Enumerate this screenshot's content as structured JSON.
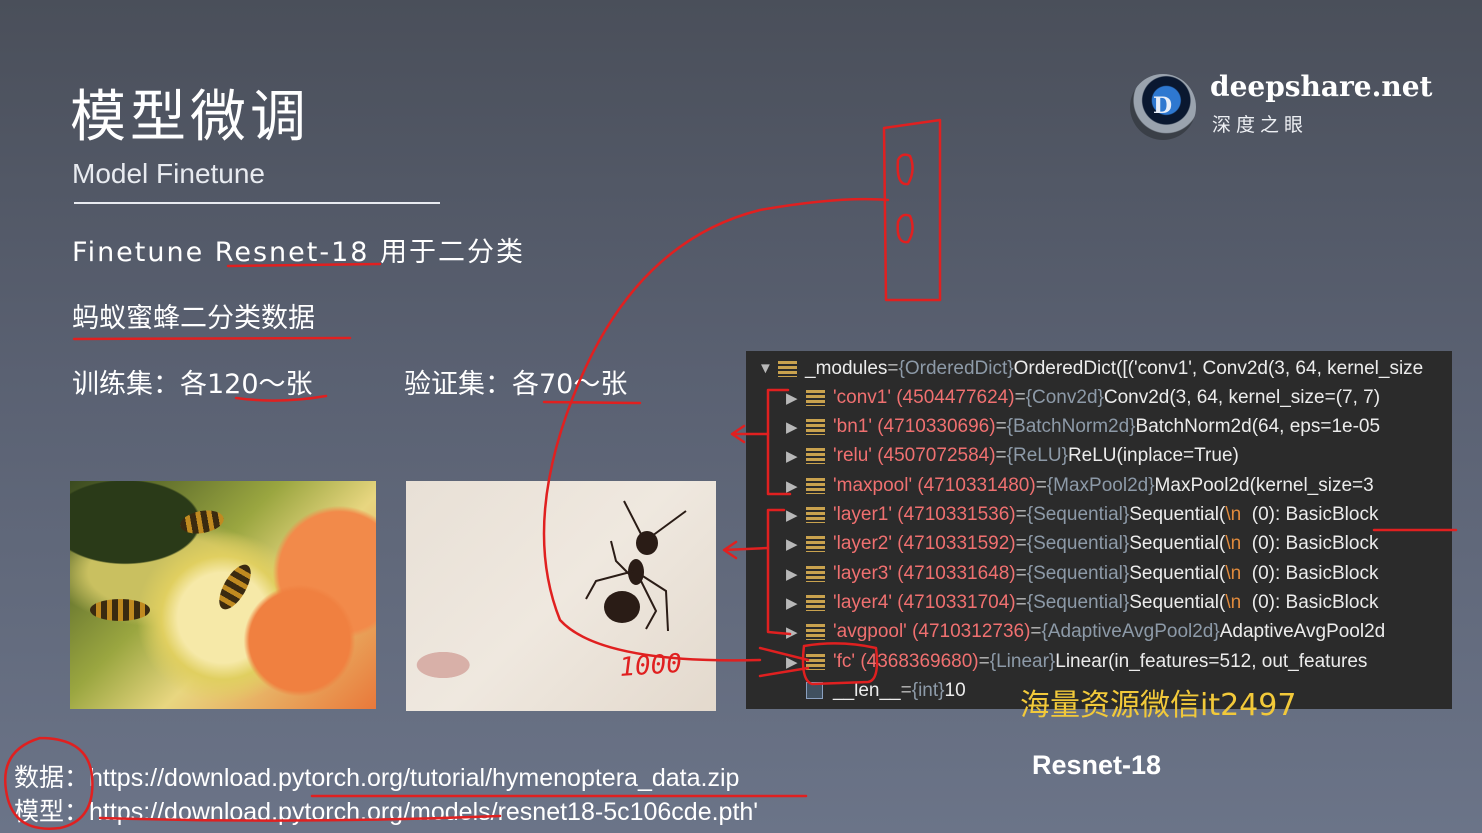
{
  "slide": {
    "title": "模型微调",
    "subtitle": "Model Finetune",
    "line1": "Finetune Resnet-18 用于二分类",
    "line2": "蚂蚁蜜蜂二分类数据",
    "train": "训练集：各120～张",
    "val": "验证集：各70～张"
  },
  "logo": {
    "letter": "D",
    "brand": "deepshare.net",
    "brand_cn": "深度之眼"
  },
  "panel": {
    "rows": [
      {
        "arrow": "▼",
        "key": "_modules",
        "key_plain": true,
        "type": "{OrderedDict}",
        "value": "OrderedDict([('conv1', Conv2d(3, 64, kernel_size"
      },
      {
        "arrow": "▶",
        "key": "'conv1' (4504477624)",
        "type": "{Conv2d}",
        "value": "Conv2d(3, 64, kernel_size=(7, 7)"
      },
      {
        "arrow": "▶",
        "key": "'bn1' (4710330696)",
        "type": "{BatchNorm2d}",
        "value": "BatchNorm2d(64, eps=1e-05"
      },
      {
        "arrow": "▶",
        "key": "'relu' (4507072584)",
        "type": "{ReLU}",
        "value": "ReLU(inplace=True)"
      },
      {
        "arrow": "▶",
        "key": "'maxpool' (4710331480)",
        "type": "{MaxPool2d}",
        "value": "MaxPool2d(kernel_size=3"
      },
      {
        "arrow": "▶",
        "key": "'layer1' (4710331536)",
        "type": "{Sequential}",
        "value": "Sequential(",
        "nl": "\\n",
        "tail": "  (0): BasicBlock"
      },
      {
        "arrow": "▶",
        "key": "'layer2' (4710331592)",
        "type": "{Sequential}",
        "value": "Sequential(",
        "nl": "\\n",
        "tail": "  (0): BasicBlock"
      },
      {
        "arrow": "▶",
        "key": "'layer3' (4710331648)",
        "type": "{Sequential}",
        "value": "Sequential(",
        "nl": "\\n",
        "tail": "  (0): BasicBlock"
      },
      {
        "arrow": "▶",
        "key": "'layer4' (4710331704)",
        "type": "{Sequential}",
        "value": "Sequential(",
        "nl": "\\n",
        "tail": "  (0): BasicBlock"
      },
      {
        "arrow": "▶",
        "key": "'avgpool' (4710312736)",
        "type": "{AdaptiveAvgPool2d}",
        "value": "AdaptiveAvgPool2d"
      },
      {
        "arrow": "▶",
        "key": "'fc' (4368369680)",
        "type": "{Linear}",
        "value": "Linear(in_features=512, out_features"
      },
      {
        "arrow": "",
        "key": "__len__",
        "key_plain": true,
        "type": "{int}",
        "value": "10",
        "int_icon": true
      }
    ]
  },
  "watermark": "海量资源微信it2497",
  "caption": "Resnet-18",
  "links": {
    "data_label": "数据：",
    "data_url": "https://download.pytorch.org/tutorial/hymenoptera_data.zip",
    "model_label": "模型：",
    "model_url": "https://download.pytorch.org/models/resnet18-5c106cde.pth'"
  },
  "annotations": {
    "handwritten_1000": "1000"
  },
  "colors": {
    "annotation": "#e02020",
    "key": "#f07070",
    "watermark": "#f2c93a"
  }
}
